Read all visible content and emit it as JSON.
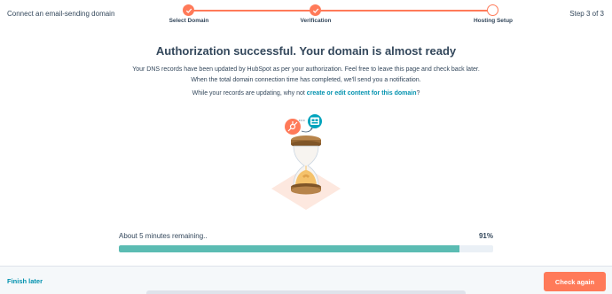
{
  "header": {
    "title": "Connect an email-sending domain",
    "step_count": "Step 3 of 3"
  },
  "stepper": {
    "steps": [
      {
        "label": "Select Domain",
        "state": "complete"
      },
      {
        "label": "Verification",
        "state": "complete"
      },
      {
        "label": "Hosting Setup",
        "state": "current"
      }
    ]
  },
  "main": {
    "headline": "Authorization successful. Your domain is almost ready",
    "line1": "Your DNS records have been updated by HubSpot as per your authorization. Feel free to leave this page and check back later.",
    "line2": "When the total domain connection time has completed, we'll send you a notification.",
    "prompt_prefix": "While your records are updating, why not ",
    "prompt_link": "create or edit content for this domain",
    "prompt_suffix": "?"
  },
  "illustration": {
    "icons": [
      "hubspot-sprocket-icon",
      "website-icon",
      "hourglass-icon"
    ]
  },
  "progress": {
    "label": "About 5 minutes remaining..",
    "percent_text": "91%",
    "percent_value": 91
  },
  "footer": {
    "finish_later": "Finish later",
    "check_again": "Check again"
  },
  "colors": {
    "accent": "#ff7a59",
    "link": "#0091ae",
    "progress": "#5bbcb3",
    "text": "#33475b"
  }
}
